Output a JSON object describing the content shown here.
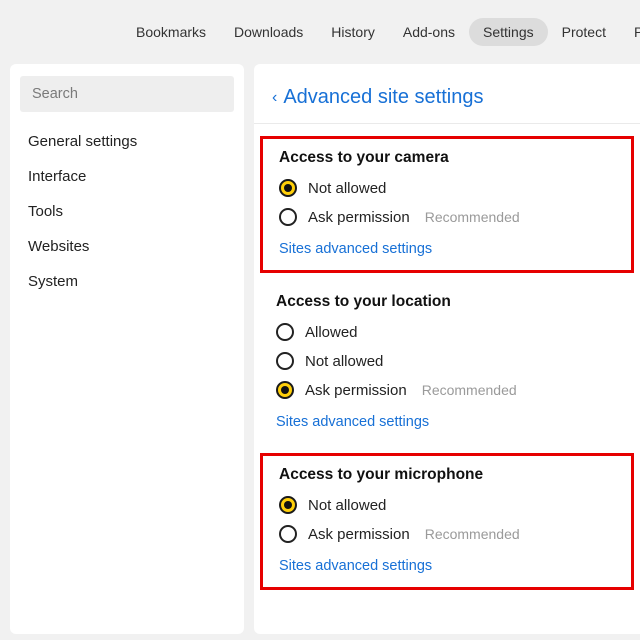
{
  "topbar": {
    "tabs": [
      {
        "label": "Bookmarks"
      },
      {
        "label": "Downloads"
      },
      {
        "label": "History"
      },
      {
        "label": "Add-ons"
      },
      {
        "label": "Settings",
        "active": true
      },
      {
        "label": "Protect"
      },
      {
        "label": "Passwords"
      }
    ]
  },
  "sidebar": {
    "search_placeholder": "Search",
    "items": [
      {
        "label": "General settings"
      },
      {
        "label": "Interface"
      },
      {
        "label": "Tools"
      },
      {
        "label": "Websites"
      },
      {
        "label": "System"
      }
    ]
  },
  "page": {
    "back": "‹",
    "title": "Advanced site settings"
  },
  "camera": {
    "title": "Access to your camera",
    "not_allowed": "Not allowed",
    "ask": "Ask permission",
    "hint": "Recommended",
    "link": "Sites advanced settings"
  },
  "location": {
    "title": "Access to your location",
    "allowed": "Allowed",
    "not_allowed": "Not allowed",
    "ask": "Ask permission",
    "hint": "Recommended",
    "link": "Sites advanced settings"
  },
  "mic": {
    "title": "Access to your microphone",
    "not_allowed": "Not allowed",
    "ask": "Ask permission",
    "hint": "Recommended",
    "link": "Sites advanced settings"
  }
}
